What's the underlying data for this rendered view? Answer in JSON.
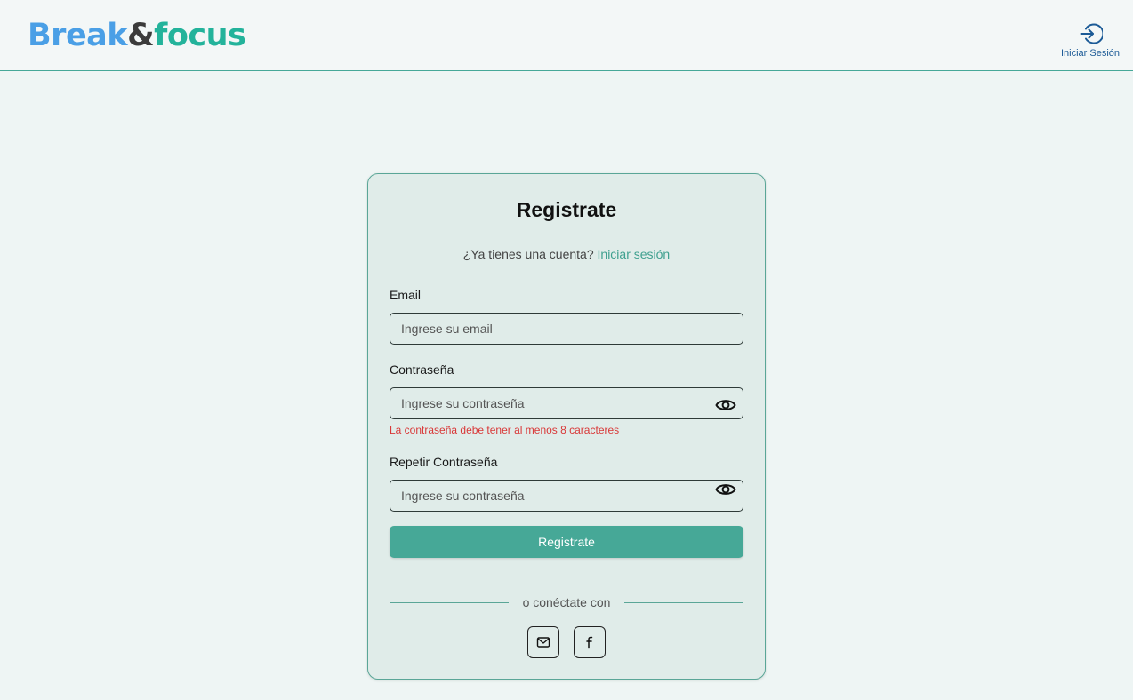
{
  "header": {
    "logo": {
      "part1": "Break",
      "part2": "&",
      "part3": "focus"
    },
    "login_nav": {
      "icon": "login-icon",
      "label": "Iniciar Sesión"
    }
  },
  "form": {
    "title": "Registrate",
    "have_account_text": "¿Ya tienes una cuenta?",
    "login_link": "Iniciar sesión",
    "email": {
      "label": "Email",
      "placeholder": "Ingrese su email",
      "value": ""
    },
    "password": {
      "label": "Contraseña",
      "placeholder": "Ingrese su contraseña",
      "value": "",
      "icon": "eye-icon"
    },
    "password_error": "La contraseña debe tener al menos 8 caracteres",
    "repeat_password": {
      "label": "Repetir Contraseña",
      "placeholder": "Ingrese su contraseña",
      "value": "",
      "icon": "eye-icon"
    },
    "submit_label": "Registrate",
    "divider_text": "o conéctate con",
    "social": [
      {
        "name": "email",
        "icon": "mail-icon"
      },
      {
        "name": "facebook",
        "icon": "facebook-icon"
      }
    ]
  },
  "colors": {
    "accent": "#46a897",
    "logo_blue": "#4a9fe6",
    "logo_dark": "#3b3b3b",
    "logo_green": "#23b39b",
    "error": "#d93838",
    "nav_blue": "#1b5a96",
    "background": "#eef5f4",
    "card": "#e0ece9"
  }
}
